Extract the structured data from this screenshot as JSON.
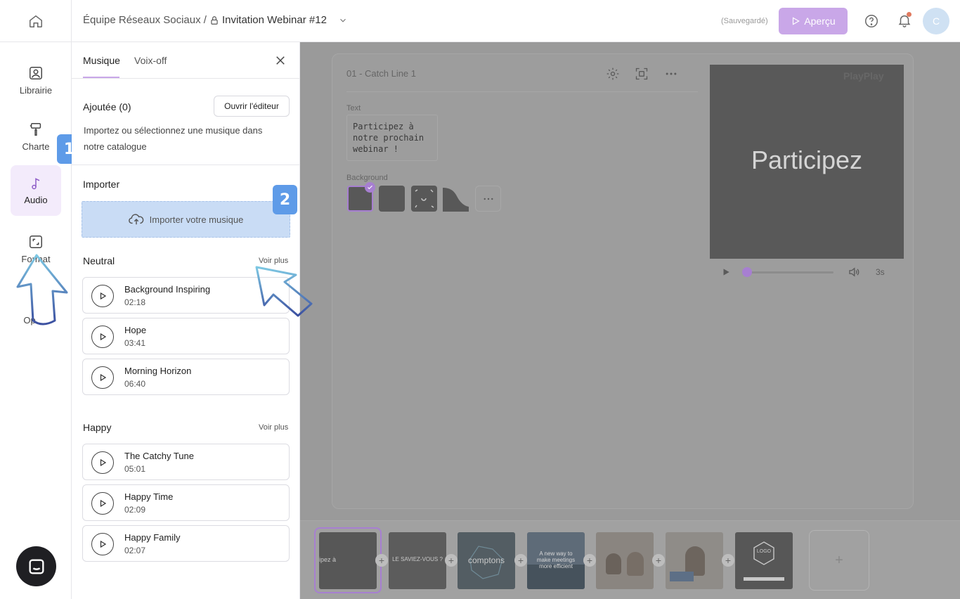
{
  "header": {
    "breadcrumb_team": "Équipe Réseaux Sociaux /",
    "breadcrumb_project": "Invitation Webinar #12",
    "save_status": "(Sauvegardé)",
    "preview_label": "Aperçu",
    "avatar_initial": "C",
    "accent_color": "#c9a7e8"
  },
  "rail": {
    "items": [
      {
        "label": "Librairie",
        "icon": "image-icon"
      },
      {
        "label": "Charte",
        "icon": "paint-roller-icon"
      },
      {
        "label": "Audio",
        "icon": "music-note-icon"
      },
      {
        "label": "Format",
        "icon": "resize-icon"
      },
      {
        "label": "Op",
        "icon": "options-icon"
      }
    ],
    "active": "Audio"
  },
  "steps": {
    "one": "1",
    "two": "2"
  },
  "audio_panel": {
    "tabs": [
      {
        "label": "Musique",
        "active": true
      },
      {
        "label": "Voix-off",
        "active": false
      }
    ],
    "added_title": "Ajoutée (0)",
    "open_editor_label": "Ouvrir l'éditeur",
    "hint": "Importez ou sélectionnez une musique dans notre catalogue",
    "import_title": "Importer",
    "import_button": "Importer votre musique",
    "see_more": "Voir plus",
    "groups": [
      {
        "title": "Neutral",
        "tracks": [
          {
            "name": "Background Inspiring",
            "duration": "02:18"
          },
          {
            "name": "Hope",
            "duration": "03:41"
          },
          {
            "name": "Morning Horizon",
            "duration": "06:40"
          }
        ]
      },
      {
        "title": "Happy",
        "tracks": [
          {
            "name": "The Catchy Tune",
            "duration": "05:01"
          },
          {
            "name": "Happy Time",
            "duration": "02:09"
          },
          {
            "name": "Happy Family",
            "duration": "02:07"
          }
        ]
      }
    ]
  },
  "scene": {
    "title": "01 - Catch Line 1",
    "text_label": "Text",
    "text_value": "Participez à notre prochain webinar !",
    "background_label": "Background",
    "preview_text": "Participez",
    "preview_brand": "PlayPlay",
    "time": "3s"
  },
  "timeline": {
    "thumbs": [
      {
        "text": "ipez à",
        "selected": true
      },
      {
        "text": "LE SAVIEZ-VOUS ?",
        "selected": false
      },
      {
        "text": "comptons",
        "selected": false
      },
      {
        "text": "A new way to make meetings more efficient",
        "selected": false
      },
      {
        "text": "",
        "selected": false
      },
      {
        "text": "",
        "selected": false
      },
      {
        "text": "LOGO",
        "selected": false
      }
    ],
    "add_symbol": "+"
  }
}
